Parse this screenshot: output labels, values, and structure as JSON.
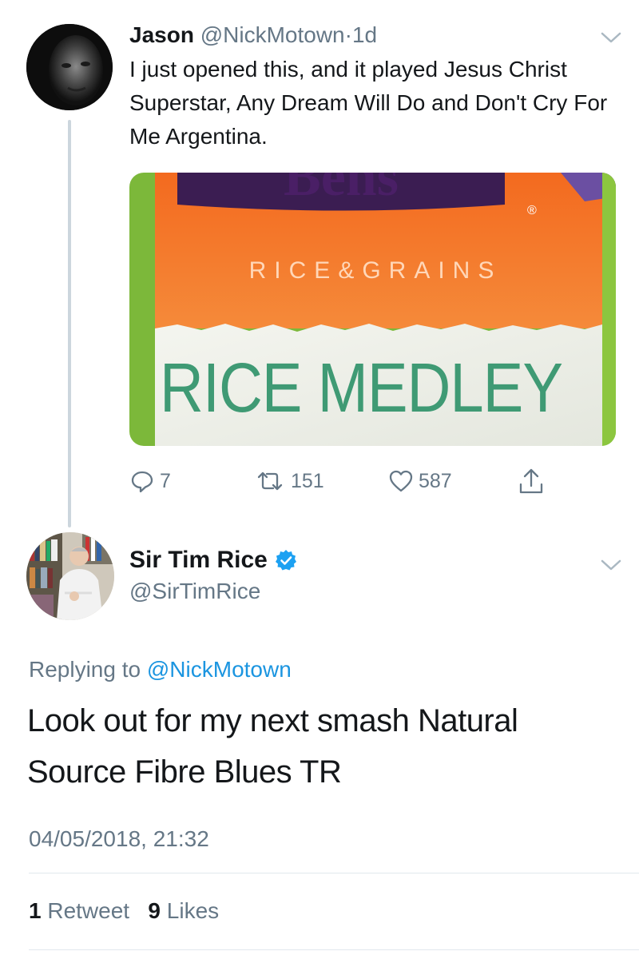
{
  "tweet1": {
    "display_name": "Jason",
    "handle": "@NickMotown",
    "separator": "·",
    "age": "1d",
    "text": "I just opened this, and it played Jesus Christ Superstar, Any Dream Will Do and Don't Cry For Me Argentina.",
    "media": {
      "brand_fragment": "Bens",
      "registered_mark": "®",
      "line1": "RICE&GRAINS",
      "line2": "RICE MEDLEY"
    },
    "actions": {
      "replies": "7",
      "retweets": "151",
      "likes": "587"
    }
  },
  "tweet2": {
    "display_name": "Sir Tim Rice",
    "verified": true,
    "handle": "@SirTimRice",
    "replying_prefix": "Replying to",
    "replying_to": "@NickMotown",
    "text": "Look out for my next smash Natural Source Fibre Blues TR",
    "timestamp": "04/05/2018, 21:32",
    "stats": {
      "retweet_count": "1",
      "retweet_label": "Retweet",
      "like_count": "9",
      "like_label": "Likes"
    }
  },
  "colors": {
    "link": "#1b95e0",
    "secondary_text": "#657786",
    "primary_text": "#14171a",
    "thread_line": "#ccd6dd",
    "verified_badge": "#1da1f2"
  },
  "icons": [
    "reply-icon",
    "retweet-icon",
    "like-icon",
    "share-icon",
    "chevron-down-icon",
    "verified-badge-icon"
  ]
}
